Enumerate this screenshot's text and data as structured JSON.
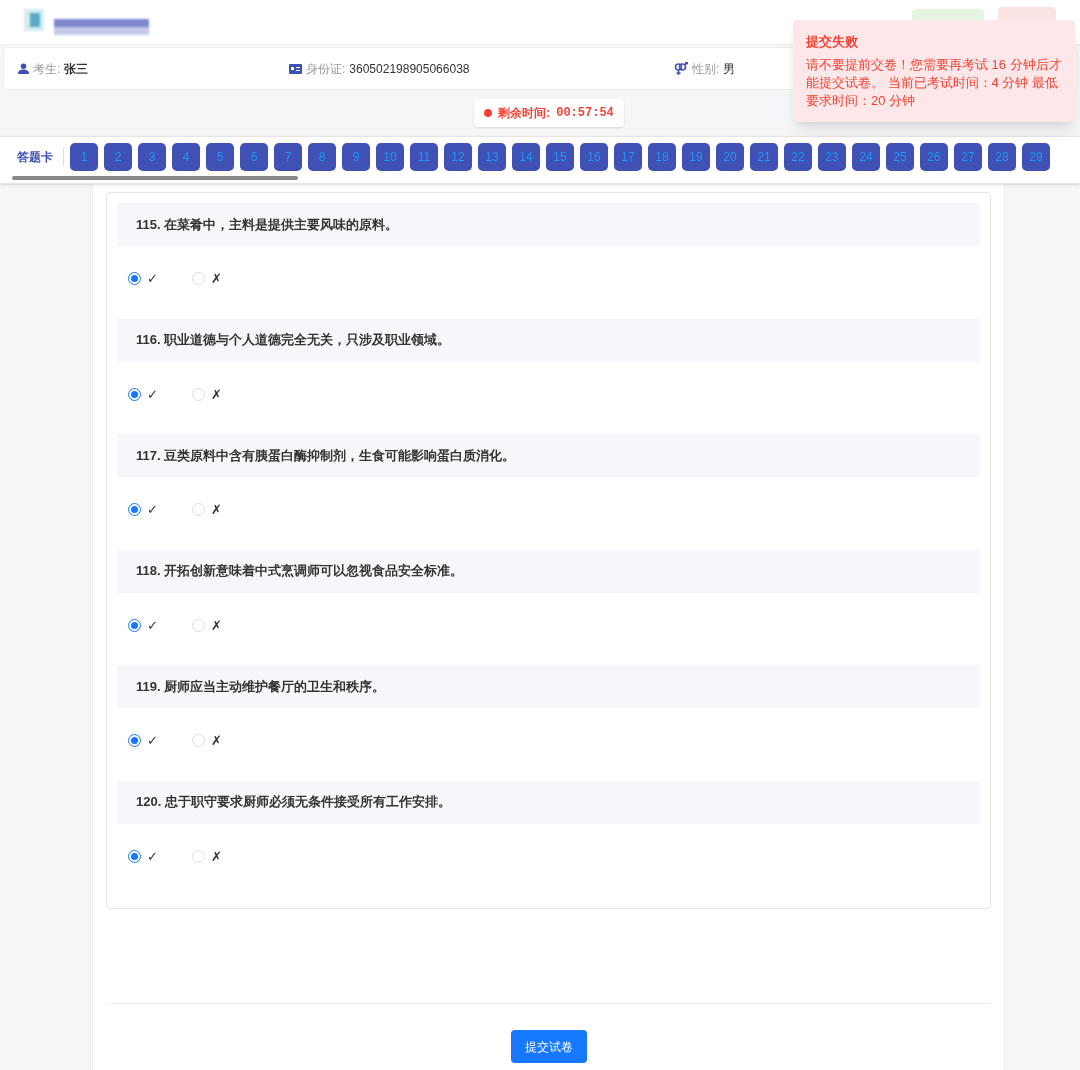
{
  "candidate": {
    "name_label": "考生:",
    "name": "张三",
    "id_label": "身份证:",
    "id_number": "360502198905066038",
    "gender_label": "性别:",
    "gender": "男"
  },
  "timer": {
    "label": "剩余时间:",
    "value": "00:57:54"
  },
  "answer_card": {
    "label": "答题卡",
    "numbers": [
      "1",
      "2",
      "3",
      "4",
      "5",
      "6",
      "7",
      "8",
      "9",
      "10",
      "11",
      "12",
      "13",
      "14",
      "15",
      "16",
      "17",
      "18",
      "19",
      "20",
      "21",
      "22",
      "23",
      "24",
      "25",
      "26",
      "27",
      "28",
      "29"
    ]
  },
  "questions": [
    {
      "title": "115. 在菜肴中，主料是提供主要风味的原料。",
      "options": [
        {
          "label": "✓",
          "selected": true
        },
        {
          "label": "✗",
          "selected": false
        }
      ]
    },
    {
      "title": "116. 职业道德与个人道德完全无关，只涉及职业领域。",
      "options": [
        {
          "label": "✓",
          "selected": true
        },
        {
          "label": "✗",
          "selected": false
        }
      ]
    },
    {
      "title": "117. 豆类原料中含有胰蛋白酶抑制剂，生食可能影响蛋白质消化。",
      "options": [
        {
          "label": "✓",
          "selected": true
        },
        {
          "label": "✗",
          "selected": false
        }
      ]
    },
    {
      "title": "118. 开拓创新意味着中式烹调师可以忽视食品安全标准。",
      "options": [
        {
          "label": "✓",
          "selected": true
        },
        {
          "label": "✗",
          "selected": false
        }
      ]
    },
    {
      "title": "119. 厨师应当主动维护餐厅的卫生和秩序。",
      "options": [
        {
          "label": "✓",
          "selected": true
        },
        {
          "label": "✗",
          "selected": false
        }
      ]
    },
    {
      "title": "120. 忠于职守要求厨师必须无条件接受所有工作安排。",
      "options": [
        {
          "label": "✓",
          "selected": true
        },
        {
          "label": "✗",
          "selected": false
        }
      ]
    }
  ],
  "submit_button": "提交试卷",
  "toast": {
    "title": "提交失败",
    "message": "请不要提前交卷！您需要再考试 16 分钟后才能提交试卷。 当前已考试时间：4 分钟 最低要求时间：20 分钟"
  }
}
